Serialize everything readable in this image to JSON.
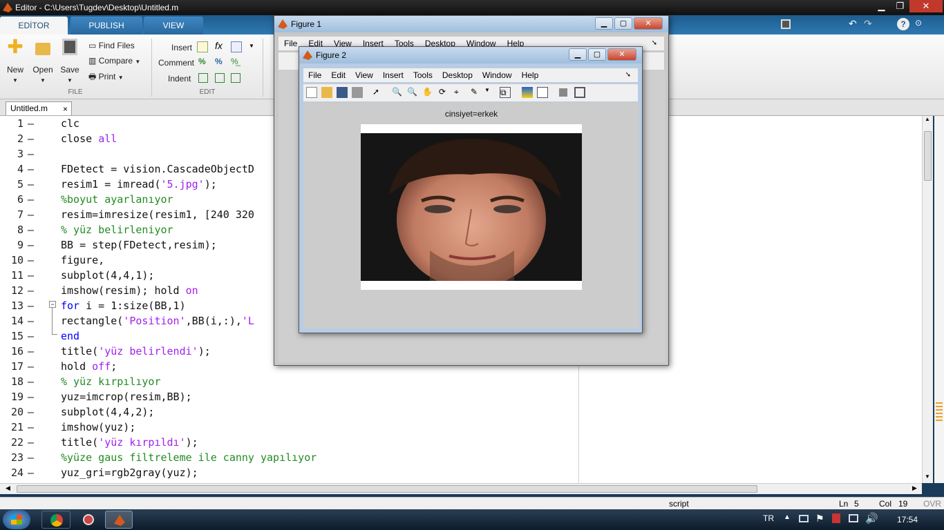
{
  "window": {
    "title": "Editor - C:\\Users\\Tugdev\\Desktop\\Untitled.m"
  },
  "ribbon": {
    "tabs": [
      "EDİTOR",
      "PUBLISH",
      "VIEW"
    ],
    "file_group": {
      "new": "New",
      "open": "Open",
      "save": "Save",
      "find_files": "Find Files",
      "compare": "Compare",
      "print": "Print",
      "label": "FILE"
    },
    "edit_group": {
      "insert": "Insert",
      "comment": "Comment",
      "indent": "Indent",
      "label": "EDIT"
    }
  },
  "doc_tab": {
    "label": "Untitled.m",
    "close": "×"
  },
  "editor": {
    "lines": [
      {
        "n": "1",
        "code": [
          [
            "clc",
            ""
          ]
        ]
      },
      {
        "n": "2",
        "code": [
          [
            "close ",
            ""
          ],
          [
            "all",
            "str"
          ]
        ]
      },
      {
        "n": "3",
        "code": []
      },
      {
        "n": "4",
        "code": [
          [
            "FDetect = vision.CascadeObjectD",
            ""
          ]
        ]
      },
      {
        "n": "5",
        "code": [
          [
            "resim1 = imread(",
            ""
          ],
          [
            "'5.jpg'",
            "str"
          ],
          [
            ");",
            ""
          ]
        ]
      },
      {
        "n": "6",
        "code": [
          [
            "%boyut ayarlanıyor",
            "cmt"
          ]
        ]
      },
      {
        "n": "7",
        "code": [
          [
            "resim=imresize(resim1, [240 320",
            ""
          ]
        ]
      },
      {
        "n": "8",
        "code": [
          [
            "% yüz belirleniyor",
            "cmt"
          ]
        ]
      },
      {
        "n": "9",
        "code": [
          [
            "BB = step(FDetect,resim);",
            ""
          ]
        ]
      },
      {
        "n": "10",
        "code": [
          [
            "figure,",
            ""
          ]
        ]
      },
      {
        "n": "11",
        "code": [
          [
            "subplot(4,4,1);",
            ""
          ]
        ]
      },
      {
        "n": "12",
        "code": [
          [
            "imshow(resim); hold ",
            ""
          ],
          [
            "on",
            "str"
          ]
        ]
      },
      {
        "n": "13",
        "code": [
          [
            "for",
            "kw"
          ],
          [
            " i = 1:size(BB,1)",
            ""
          ]
        ]
      },
      {
        "n": "14",
        "code": [
          [
            "rectangle(",
            ""
          ],
          [
            "'Position'",
            "str"
          ],
          [
            ",BB(i,:),",
            ""
          ],
          [
            "'L",
            "str"
          ]
        ]
      },
      {
        "n": "15",
        "code": [
          [
            "end",
            "kw"
          ]
        ]
      },
      {
        "n": "16",
        "code": [
          [
            "title(",
            ""
          ],
          [
            "'yüz belirlendi'",
            "str"
          ],
          [
            ");",
            ""
          ]
        ]
      },
      {
        "n": "17",
        "code": [
          [
            "hold ",
            ""
          ],
          [
            "off",
            "str"
          ],
          [
            ";",
            ""
          ]
        ]
      },
      {
        "n": "18",
        "code": [
          [
            "% yüz kırpılıyor",
            "cmt"
          ]
        ]
      },
      {
        "n": "19",
        "code": [
          [
            "yuz=imcrop(resim,BB);",
            ""
          ]
        ]
      },
      {
        "n": "20",
        "code": [
          [
            "subplot(4,4,2);",
            ""
          ]
        ]
      },
      {
        "n": "21",
        "code": [
          [
            "imshow(yuz);",
            ""
          ]
        ]
      },
      {
        "n": "22",
        "code": [
          [
            "title(",
            ""
          ],
          [
            "'yüz kırpıldı'",
            "str"
          ],
          [
            ");",
            ""
          ]
        ]
      },
      {
        "n": "23",
        "code": [
          [
            "%yüze gaus filtreleme ile canny yapılıyor",
            "cmt"
          ]
        ]
      },
      {
        "n": "24",
        "code": [
          [
            "yuz_gri=rgb2gray(yuz);",
            ""
          ]
        ]
      }
    ]
  },
  "status": {
    "mode": "script",
    "ln_label": "Ln",
    "ln": "5",
    "col_label": "Col",
    "col": "19",
    "ovr": "OVR"
  },
  "figure1": {
    "title": "Figure 1",
    "menu": [
      "File",
      "Edit",
      "View",
      "Insert",
      "Tools",
      "Desktop",
      "Window",
      "Help"
    ]
  },
  "figure2": {
    "title": "Figure 2",
    "menu": [
      "File",
      "Edit",
      "View",
      "Insert",
      "Tools",
      "Desktop",
      "Window",
      "Help"
    ],
    "axes_title": "cinsiyet=erkek"
  },
  "taskbar": {
    "lang": "TR",
    "time": "17:54"
  }
}
